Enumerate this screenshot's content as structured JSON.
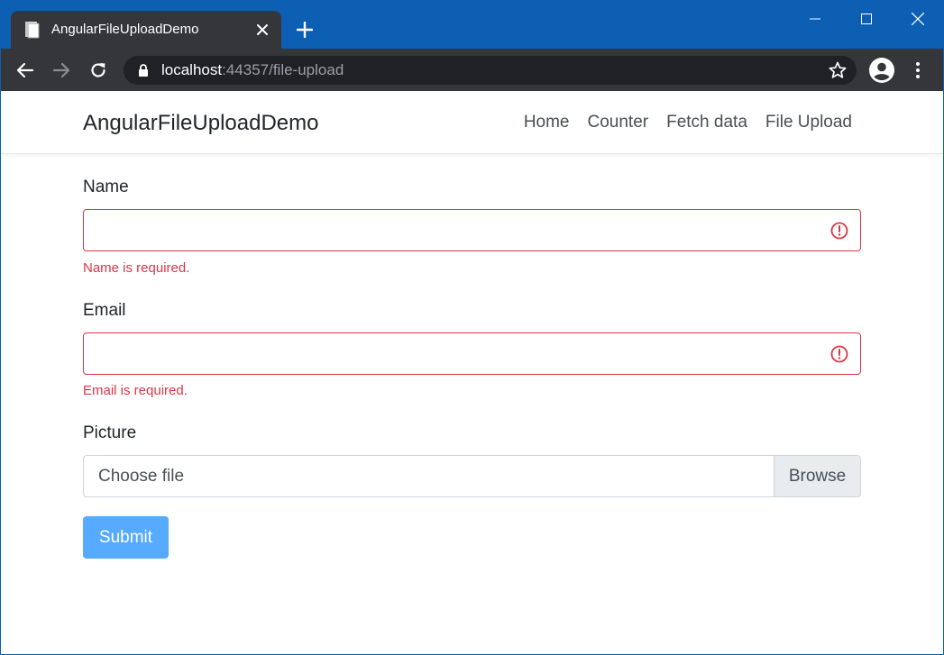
{
  "browser": {
    "tab_title": "AngularFileUploadDemo",
    "url_host": "localhost",
    "url_rest": ":44357/file-upload"
  },
  "navbar": {
    "brand": "AngularFileUploadDemo",
    "links": [
      "Home",
      "Counter",
      "Fetch data",
      "File Upload"
    ]
  },
  "form": {
    "name_label": "Name",
    "name_value": "",
    "name_error": "Name is required.",
    "email_label": "Email",
    "email_value": "",
    "email_error": "Email is required.",
    "picture_label": "Picture",
    "file_placeholder": "Choose file",
    "browse_label": "Browse",
    "submit_label": "Submit"
  },
  "colors": {
    "titlebar": "#0c5fb2",
    "chrome_dark": "#35363a",
    "omnibox": "#202124",
    "error": "#dc3545",
    "primary_disabled": "#56aaff"
  }
}
